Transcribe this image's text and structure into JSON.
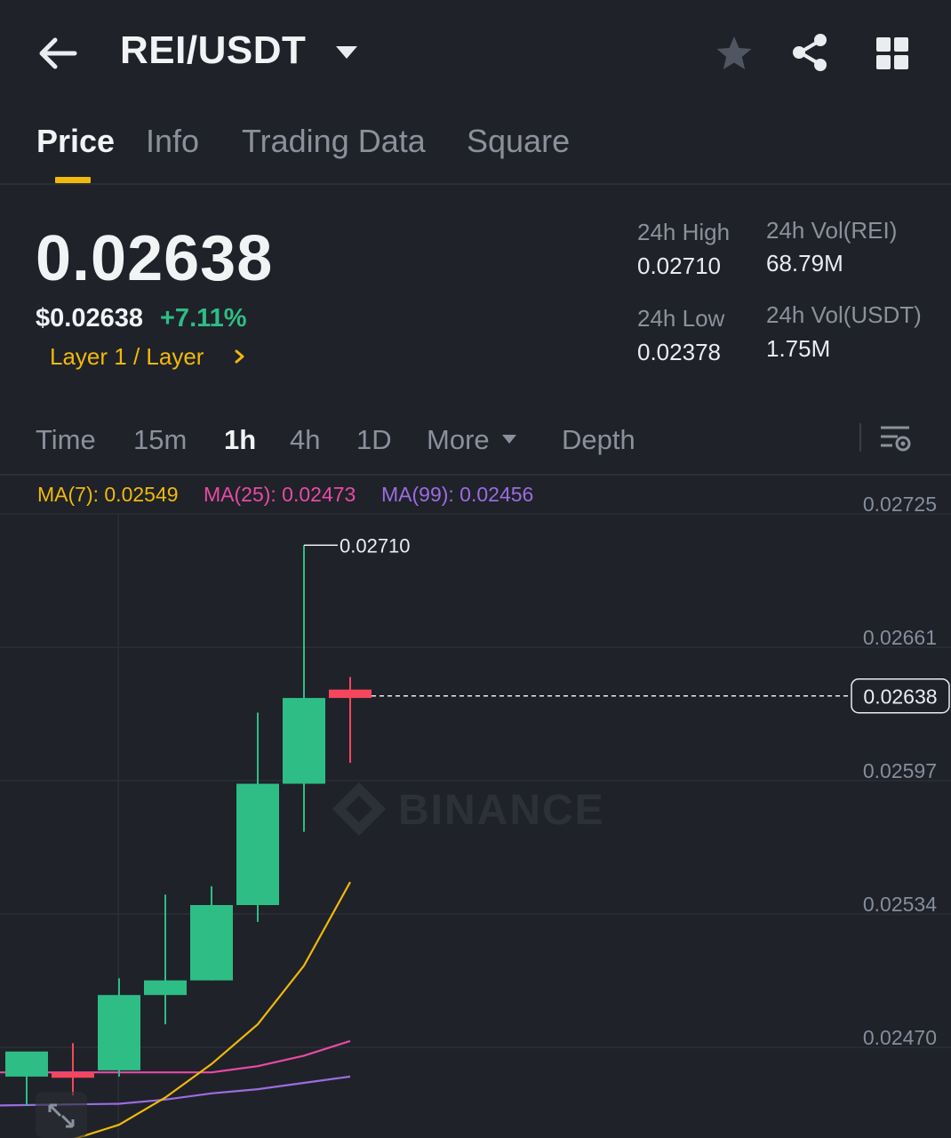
{
  "header": {
    "back_icon": "arrow-left-icon",
    "pair": "REI/USDT",
    "dropdown_icon": "caret-down-icon",
    "favorite_icon": "star-icon",
    "share_icon": "share-icon",
    "layout_icon": "grid-icon"
  },
  "tabs": [
    {
      "label": "Price",
      "active": true
    },
    {
      "label": "Info"
    },
    {
      "label": "Trading Data"
    },
    {
      "label": "Square"
    }
  ],
  "price": {
    "last": "0.02638",
    "usd": "$0.02638",
    "change": "+7.11%",
    "category": "Layer 1 / Layer"
  },
  "stats": {
    "high_label": "24h High",
    "high_value": "0.02710",
    "low_label": "24h Low",
    "low_value": "0.02378",
    "vol_base_label": "24h Vol(REI)",
    "vol_base_value": "68.79M",
    "vol_quote_label": "24h Vol(USDT)",
    "vol_quote_value": "1.75M"
  },
  "intervals": [
    {
      "label": "Time"
    },
    {
      "label": "15m"
    },
    {
      "label": "1h",
      "active": true
    },
    {
      "label": "4h"
    },
    {
      "label": "1D"
    },
    {
      "label": "More"
    },
    {
      "label": "Depth"
    }
  ],
  "ma_legend": [
    {
      "label": "MA(7): 0.02549",
      "color": "#f0b90b"
    },
    {
      "label": "MA(25): 0.02473",
      "color": "#e84aa5"
    },
    {
      "label": "MA(99): 0.02456",
      "color": "#9c6ce0"
    }
  ],
  "colors": {
    "up": "#2ebd85",
    "down": "#f6465d",
    "accent": "#f0b90b",
    "background": "#1f2229"
  },
  "chart_data": {
    "type": "candlestick",
    "interval": "1h",
    "y_ticks": [
      "0.02725",
      "0.02661",
      "0.02597",
      "0.02534",
      "0.02470"
    ],
    "ylim": [
      0.02414,
      0.02736
    ],
    "current_price": "0.02638",
    "high_marker": "0.02710",
    "watermark": "BINANCE",
    "candles": [
      {
        "o": 0.02456,
        "h": 0.02459,
        "l": 0.02442,
        "c": 0.02468
      },
      {
        "o": 0.02458,
        "h": 0.02472,
        "l": 0.02447,
        "c": 0.02456
      },
      {
        "o": 0.02459,
        "h": 0.02503,
        "l": 0.02456,
        "c": 0.02495
      },
      {
        "o": 0.02495,
        "h": 0.02543,
        "l": 0.02481,
        "c": 0.02502
      },
      {
        "o": 0.02502,
        "h": 0.02547,
        "l": 0.02502,
        "c": 0.02538
      },
      {
        "o": 0.02538,
        "h": 0.0263,
        "l": 0.0253,
        "c": 0.02596
      },
      {
        "o": 0.02596,
        "h": 0.0271,
        "l": 0.02573,
        "c": 0.02637
      },
      {
        "o": 0.02641,
        "h": 0.02647,
        "l": 0.02606,
        "c": 0.02637
      }
    ],
    "ma7": [
      0.02426,
      0.02433,
      0.02446,
      0.02462,
      0.02481,
      0.02509,
      0.02549
    ],
    "ma25": [
      0.02458,
      0.02458,
      0.02458,
      0.02461,
      0.02466,
      0.02473
    ],
    "ma99": [
      0.02443,
      0.02445,
      0.02448,
      0.0245,
      0.02453,
      0.02456
    ]
  }
}
